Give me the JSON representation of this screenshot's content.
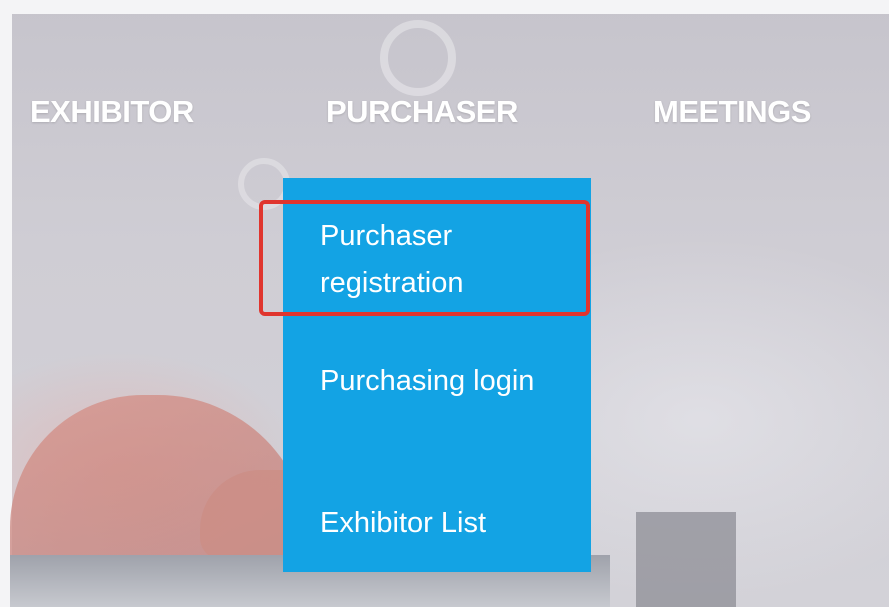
{
  "nav": {
    "items": [
      {
        "label": "EXHIBITOR"
      },
      {
        "label": "PURCHASER"
      },
      {
        "label": "MEETINGS"
      }
    ]
  },
  "dropdown": {
    "items": [
      {
        "label": "Purchaser registration"
      },
      {
        "label": "Purchasing login"
      },
      {
        "label": "Exhibitor List"
      }
    ]
  },
  "colors": {
    "dropdown_bg": "#13a3e4",
    "highlight_border": "#e0352e",
    "nav_text": "#ffffff"
  }
}
